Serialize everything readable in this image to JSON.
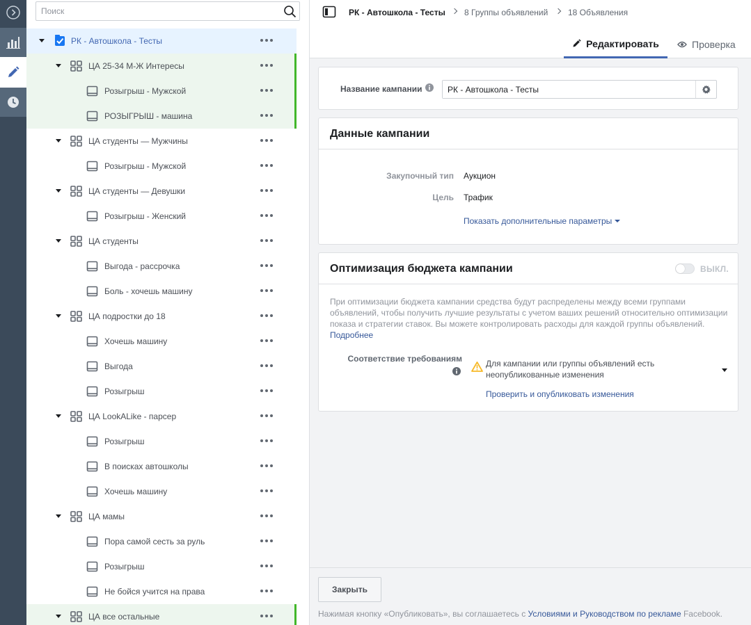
{
  "search": {
    "placeholder": "Поиск"
  },
  "tree": [
    {
      "level": 0,
      "type": "campaign",
      "label": "РК - Автошкола - Тесты",
      "highlight": "blue",
      "caret": true,
      "checked": true
    },
    {
      "level": 1,
      "type": "adset",
      "label": "ЦА 25-34 М-Ж Интересы",
      "highlight": "green",
      "caret": true
    },
    {
      "level": 2,
      "type": "ad",
      "label": "Розыгрыш - Мужской",
      "highlight": "green"
    },
    {
      "level": 2,
      "type": "ad",
      "label": "РОЗЫГРЫШ - машина",
      "highlight": "green"
    },
    {
      "level": 1,
      "type": "adset",
      "label": "ЦА студенты — Мужчины",
      "caret": true
    },
    {
      "level": 2,
      "type": "ad",
      "label": "Розыгрыш - Мужской"
    },
    {
      "level": 1,
      "type": "adset",
      "label": "ЦА студенты — Девушки",
      "caret": true
    },
    {
      "level": 2,
      "type": "ad",
      "label": "Розыгрыш - Женский"
    },
    {
      "level": 1,
      "type": "adset",
      "label": "ЦА студенты",
      "caret": true
    },
    {
      "level": 2,
      "type": "ad",
      "label": "Выгода - рассрочка"
    },
    {
      "level": 2,
      "type": "ad",
      "label": "Боль - хочешь машину"
    },
    {
      "level": 1,
      "type": "adset",
      "label": "ЦА подростки до 18",
      "caret": true
    },
    {
      "level": 2,
      "type": "ad",
      "label": "Хочешь машину"
    },
    {
      "level": 2,
      "type": "ad",
      "label": "Выгода"
    },
    {
      "level": 2,
      "type": "ad",
      "label": "Розыгрыш"
    },
    {
      "level": 1,
      "type": "adset",
      "label": "ЦА LookALike - парсер",
      "caret": true
    },
    {
      "level": 2,
      "type": "ad",
      "label": "Розыгрыш"
    },
    {
      "level": 2,
      "type": "ad",
      "label": "В поисках автошколы"
    },
    {
      "level": 2,
      "type": "ad",
      "label": "Хочешь машину"
    },
    {
      "level": 1,
      "type": "adset",
      "label": "ЦА мамы",
      "caret": true
    },
    {
      "level": 2,
      "type": "ad",
      "label": "Пора самой сесть за руль"
    },
    {
      "level": 2,
      "type": "ad",
      "label": "Розыгрыш"
    },
    {
      "level": 2,
      "type": "ad",
      "label": "Не бойся учится на права"
    },
    {
      "level": 1,
      "type": "adset",
      "label": "ЦА все остальные",
      "highlight": "green",
      "caret": true
    }
  ],
  "breadcrumb": {
    "campaign": "РК - Автошкола - Тесты",
    "adsets": "8 Группы объявлений",
    "ads": "18 Объявления"
  },
  "tabs": {
    "edit": "Редактировать",
    "review": "Проверка"
  },
  "campaign_name": {
    "label": "Название кампании",
    "value": "РК - Автошкола - Тесты"
  },
  "campaign_data": {
    "title": "Данные кампании",
    "buying_type_label": "Закупочный тип",
    "buying_type_value": "Аукцион",
    "objective_label": "Цель",
    "objective_value": "Трафик",
    "more_params": "Показать дополнительные параметры"
  },
  "budget": {
    "title": "Оптимизация бюджета кампании",
    "toggle_label": "ВЫКЛ.",
    "description": "При оптимизации бюджета кампании средства будут распределены между всеми группами объявлений, чтобы получить лучшие результаты с учетом ваших решений относительно оптимизации показа и стратегии ставок. Вы можете контролировать расходы для каждой группы объявлений.",
    "learn_more": "Подробнее",
    "compliance_label": "Соответствие требованиям",
    "warning_text": "Для кампании или группы объявлений есть неопубликованные изменения",
    "publish_link": "Проверить и опубликовать изменения"
  },
  "footer": {
    "close_label": "Закрыть",
    "text_before": "Нажимая кнопку «Опубликовать», вы соглашаетесь с ",
    "terms_link": "Условиями и Руководством по рекламе",
    "text_after": " Facebook."
  },
  "colors": {
    "accent": "#4267b2",
    "link": "#365899",
    "highlight_blue": "#e7f3ff",
    "highlight_green": "#edf6ee",
    "status_bar": "#42b72a",
    "warning": "#f7b928",
    "rail": "#3b4a5a"
  }
}
